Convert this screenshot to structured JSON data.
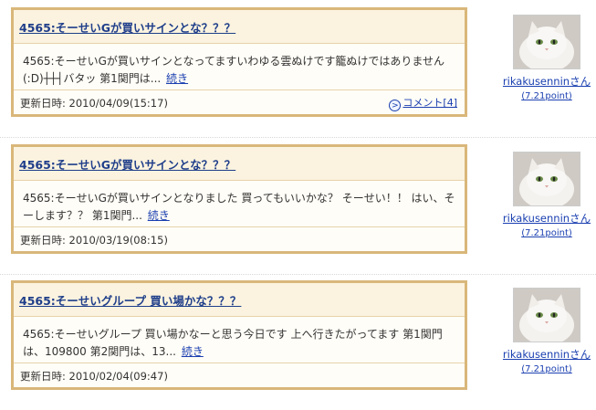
{
  "entries": [
    {
      "title": "4565:そーせいGが買いサインとな？？？",
      "excerpt": "4565:そーせいGが買いサインとなってますいわゆる雲ぬけです籠ぬけではありません(:D)┼┼┤バタッ 第1関門は...",
      "more": "続き",
      "date_label": "更新日時:",
      "date": "2010/04/09(15:17)",
      "comment": "コメント[4]",
      "author": "rikakusenninさん",
      "points": "(7.21point)"
    },
    {
      "title": "4565:そーせいGが買いサインとな？？？",
      "excerpt": "4565:そーせいGが買いサインとなりました 買ってもいいかな？ そーせい！！ はい、そーします？？ 第1関門...",
      "more": "続き",
      "date_label": "更新日時:",
      "date": "2010/03/19(08:15)",
      "author": "rikakusenninさん",
      "points": "(7.21point)"
    },
    {
      "title": "4565:そーせいグループ 買い場かな？？？",
      "excerpt": "4565:そーせいグループ 買い場かなーと思う今日です 上へ行きたがってます 第1関門は、109800 第2関門は、13...",
      "more": "続き",
      "date_label": "更新日時:",
      "date": "2010/02/04(09:47)",
      "author": "rikakusenninさん",
      "points": "(7.21point)"
    }
  ],
  "colors": {
    "card_border": "#d9b77a",
    "title_bg": "#fbf3df",
    "link": "#1a3fb0",
    "title_link": "#1f3e8a"
  },
  "icons": {
    "comment": "arrow-circle-icon",
    "avatar": "white-cat-photo"
  }
}
